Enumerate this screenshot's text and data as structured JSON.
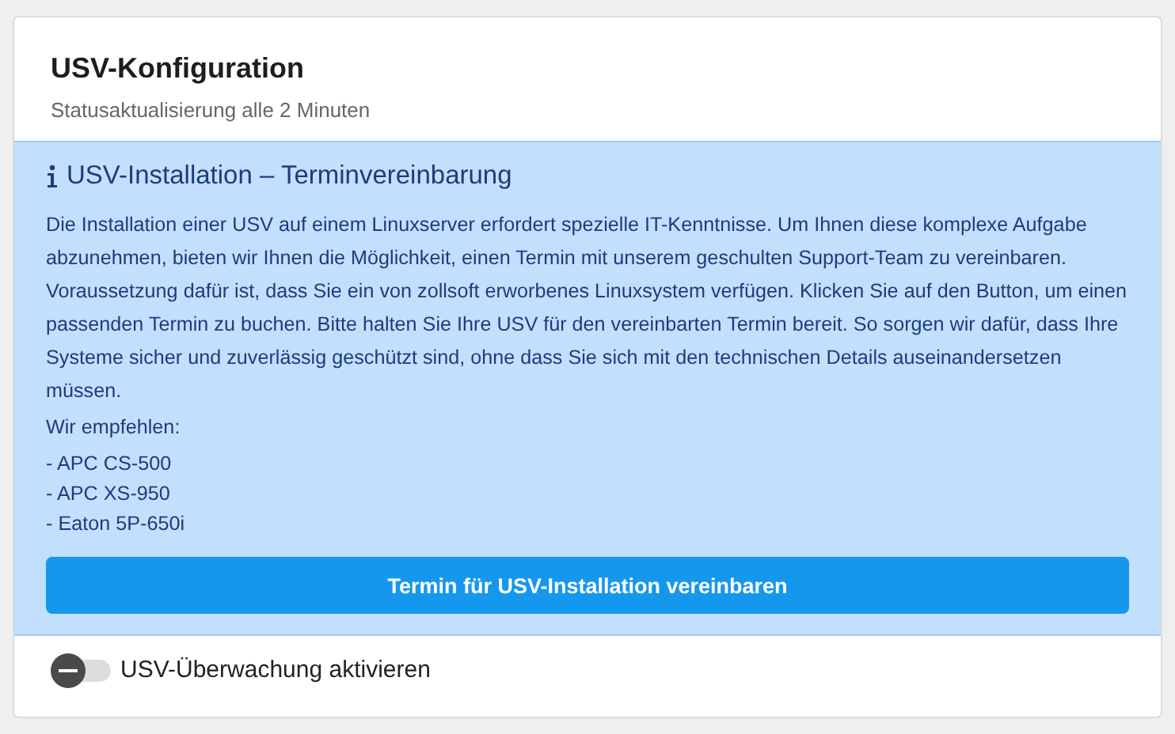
{
  "card": {
    "title": "USV-Konfiguration",
    "subtitle": "Statusaktualisierung alle 2 Minuten"
  },
  "info": {
    "heading": "USV-Installation – Terminvereinbarung",
    "text": "Die Installation einer USV auf einem Linuxserver erfordert spezielle IT-Kenntnisse. Um Ihnen diese komplexe Aufgabe abzunehmen, bieten wir Ihnen die Möglichkeit, einen Termin mit unserem geschulten Support-Team zu vereinbaren. Voraussetzung dafür ist, dass Sie ein von zollsoft erworbenes Linuxsystem verfügen. Klicken Sie auf den Button, um einen passenden Termin zu buchen. Bitte halten Sie Ihre USV für den vereinbarten Termin bereit. So sorgen wir dafür, dass Ihre Systeme sicher und zuverlässig geschützt sind, ohne dass Sie sich mit den technischen Details auseinandersetzen müssen.",
    "recommend_label": "Wir empfehlen:",
    "recommendations": [
      "- APC CS-500",
      "- APC XS-950",
      "- Eaton 5P-650i"
    ],
    "button": "Termin für USV-Installation vereinbaren"
  },
  "monitoring": {
    "label": "USV-Überwachung aktivieren",
    "on": false
  }
}
